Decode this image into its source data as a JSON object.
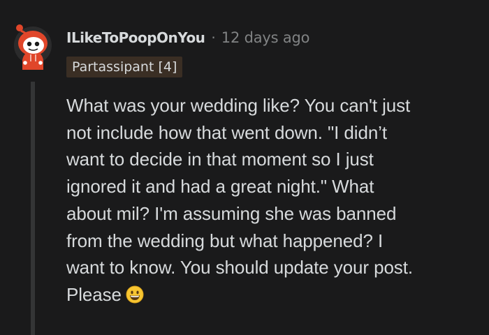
{
  "comment": {
    "username": "ILikeToPoopOnYou",
    "separator": "·",
    "timestamp": "12 days ago",
    "flair": "Partassipant [4]",
    "avatar_icon": "snoo-avatar-icon",
    "body_lines": [
      "What was your wedding like? You can't just",
      "not include how that went down. \"I didn’t",
      "want to decide in that moment so I just",
      "ignored it and had a great night.\" What",
      "about mil? I'm assuming she was banned",
      "from the wedding but what happened? I",
      "want to know. You should update your post.",
      "Please"
    ],
    "emoji_icon": "grinning-face-emoji-icon"
  },
  "colors": {
    "background": "#1a1a1b",
    "text": "#d7dadc",
    "meta": "#818384",
    "flair_bg": "#3a2e24",
    "thread_line": "#343536",
    "avatar_orange": "#e0462a"
  }
}
